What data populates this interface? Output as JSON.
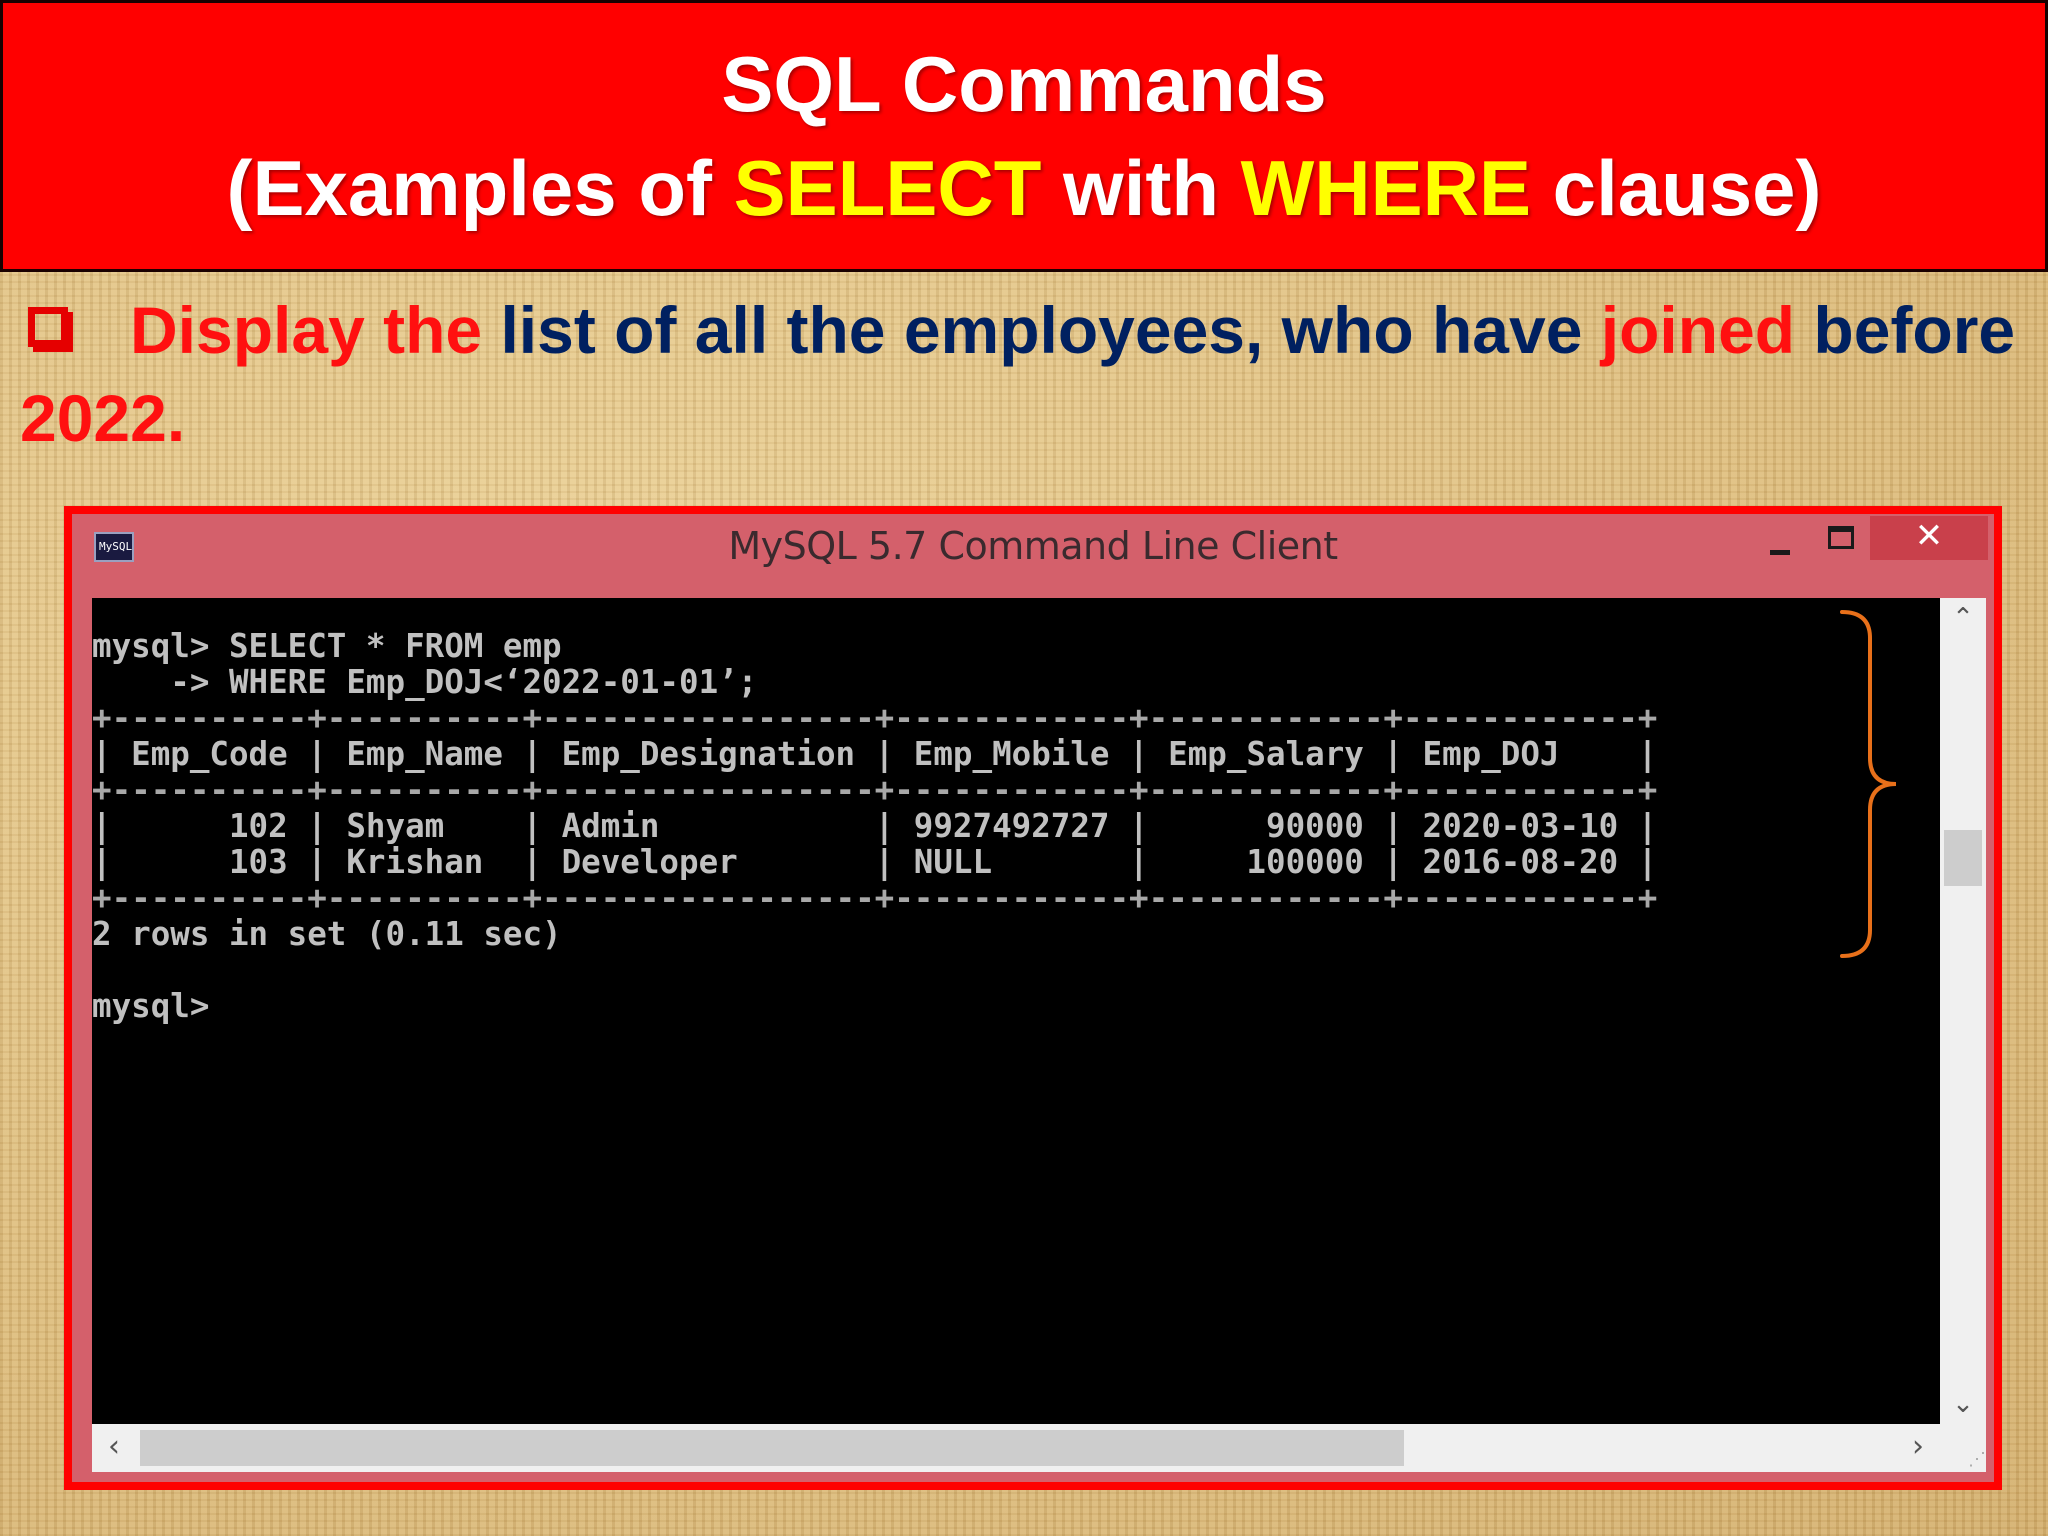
{
  "slide": {
    "title_line1": "SQL Commands",
    "title_line2_prefix": "(Examples of ",
    "title_keyword1": "SELECT",
    "title_middle": " with ",
    "title_keyword2": "WHERE",
    "title_suffix": " clause)",
    "question": {
      "part1": "Display the",
      "part2": " list of all the employees, who have ",
      "part3": "joined",
      "part4": " before ",
      "part5": "2022."
    }
  },
  "window": {
    "icon_label": "MySQL",
    "title": "MySQL 5.7 Command Line Client",
    "close_symbol": "✕"
  },
  "console": {
    "query_line1": "mysql> SELECT * FROM emp",
    "query_line2": "    -> WHERE Emp_DOJ<‘2022-01-01’;",
    "rule": "+----------+----------+-----------------+------------+------------+------------+",
    "header": "| Emp_Code | Emp_Name | Emp_Designation | Emp_Mobile | Emp_Salary | Emp_DOJ    |",
    "rows": [
      "|      102 | Shyam    | Admin           | 9927492727 |      90000 | 2020-03-10 |",
      "|      103 | Krishan  | Developer       | NULL       |     100000 | 2016-08-20 |"
    ],
    "summary": "2 rows in set (0.11 sec)",
    "prompt": "mysql>",
    "columns": [
      "Emp_Code",
      "Emp_Name",
      "Emp_Designation",
      "Emp_Mobile",
      "Emp_Salary",
      "Emp_DOJ"
    ],
    "result_rows": [
      [
        "102",
        "Shyam",
        "Admin",
        "9927492727",
        "90000",
        "2020-03-10"
      ],
      [
        "103",
        "Krishan",
        "Developer",
        "NULL",
        "100000",
        "2016-08-20"
      ]
    ]
  },
  "scrollbars": {
    "up_arrow": "⌃",
    "down_arrow": "⌄",
    "left_arrow": "‹",
    "right_arrow": "›"
  },
  "colors": {
    "banner": "#ff0000",
    "keyword_highlight": "#ffff00",
    "question_red": "#ff1010",
    "question_navy": "#002060",
    "window_frame": "#d4606b",
    "console_bg": "#000000",
    "console_text": "#c0c0c0",
    "brace": "#e8701a"
  }
}
